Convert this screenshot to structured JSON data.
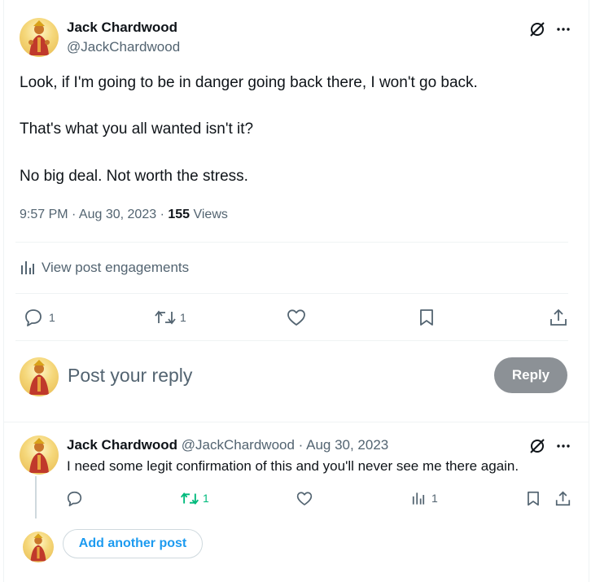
{
  "main_post": {
    "author_name": "Jack Chardwood",
    "author_handle": "@JackChardwood",
    "lines": [
      "Look, if I'm going to be in danger going back there, I won't go back.",
      "That's what you all wanted isn't it?",
      "No big deal. Not worth the stress."
    ],
    "time": "9:57 PM · Aug 30, 2023 · ",
    "views_count": "155",
    "views_label": " Views",
    "engagements_label": "View post engagements",
    "replies": "1",
    "reposts": "1"
  },
  "reply_composer": {
    "placeholder": "Post your reply",
    "button_label": "Reply"
  },
  "reply_post": {
    "author_name": "Jack Chardwood",
    "meta": "@JackChardwood · Aug 30, 2023",
    "text": "I need some legit confirmation of this and you'll never see me there again.",
    "reposts": "1",
    "views": "1"
  },
  "add_post_label": "Add another post",
  "colors": {
    "accent": "#1d9bf0",
    "repost_active": "#00ba7c",
    "muted": "#536471",
    "reply_button": "#8c9196"
  },
  "icons": [
    "grok-icon",
    "more-icon",
    "analytics-icon",
    "reply-icon",
    "repost-icon",
    "like-icon",
    "bookmark-icon",
    "share-icon"
  ]
}
